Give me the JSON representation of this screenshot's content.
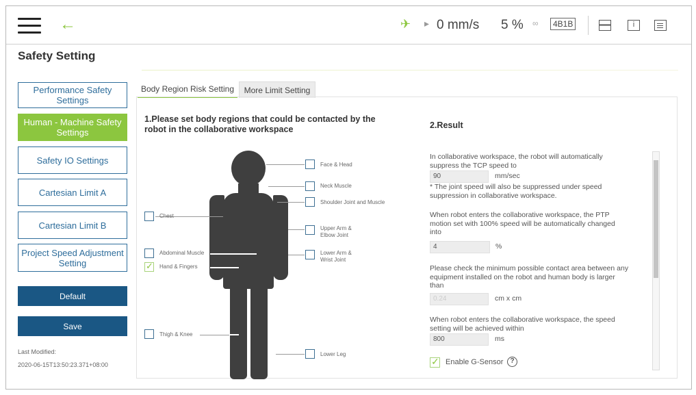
{
  "header": {
    "speed_label": "0 mm/s",
    "speed_percent": "5 %",
    "code": "4B1B"
  },
  "page_title": "Safety Setting",
  "sidebar": {
    "items": [
      {
        "label": "Performance Safety Settings"
      },
      {
        "label": "Human - Machine Safety Settings",
        "active": true
      },
      {
        "label": "Safety IO Settings"
      },
      {
        "label": "Cartesian Limit A"
      },
      {
        "label": "Cartesian Limit B"
      },
      {
        "label": "Project Speed Adjustment Setting"
      }
    ],
    "default_label": "Default",
    "save_label": "Save",
    "last_modified_label": "Last Modified:",
    "last_modified_value": "2020-06-15T13:50:23.371+08:00"
  },
  "tabs": [
    {
      "label": "Body Region Risk Setting",
      "active": true
    },
    {
      "label": "More Limit Setting",
      "active": false
    }
  ],
  "section1_title": "1.Please set body regions that could be contacted by the robot in the collaborative workspace",
  "body_regions": {
    "face_head": {
      "label": "Face & Head",
      "checked": false
    },
    "neck_muscle": {
      "label": "Neck Muscle",
      "checked": false
    },
    "shoulder": {
      "label": "Shoulder Joint and Muscle",
      "checked": false
    },
    "chest": {
      "label": "Chest",
      "checked": false
    },
    "upper_arm_line1": "Upper Arm &",
    "upper_arm_line2": "Elbow Joint",
    "abdominal": {
      "label": "Abdominal Muscle",
      "checked": false
    },
    "lower_arm_line1": "Lower Arm &",
    "lower_arm_line2": "Wrist Joint",
    "hand_fingers": {
      "label": "Hand & Fingers",
      "checked": true
    },
    "thigh_knee": {
      "label": "Thigh & Knee",
      "checked": false
    },
    "lower_leg": {
      "label": "Lower Leg",
      "checked": false
    }
  },
  "section2_title": "2.Result",
  "result": {
    "p1_line1": "In collaborative workspace, the robot will automatically",
    "p1_line2": "suppress the TCP speed to",
    "tcp_speed": "90",
    "tcp_unit": "mm/sec",
    "p1_note1": "* The joint speed will also be suppressed under speed",
    "p1_note2": "suppression in collaborative workspace.",
    "p2_line1": "When robot enters the collaborative workspace, the PTP",
    "p2_line2": "motion set with 100% speed will be automatically changed",
    "p2_line3": "into",
    "ptp_value": "4",
    "ptp_unit": "%",
    "p3_line1": "Please check the minimum possible contact area between any",
    "p3_line2": "equipment installed on the robot and human body is larger",
    "p3_line3": "than",
    "area_value": "0.24",
    "area_unit": "cm x cm",
    "p4_line1": "When robot enters the collaborative workspace, the speed",
    "p4_line2": "setting will be achieved within",
    "time_value": "800",
    "time_unit": "ms",
    "g_sensor_label": "Enable G-Sensor",
    "g_sensor_checked": true,
    "help_glyph": "?"
  }
}
